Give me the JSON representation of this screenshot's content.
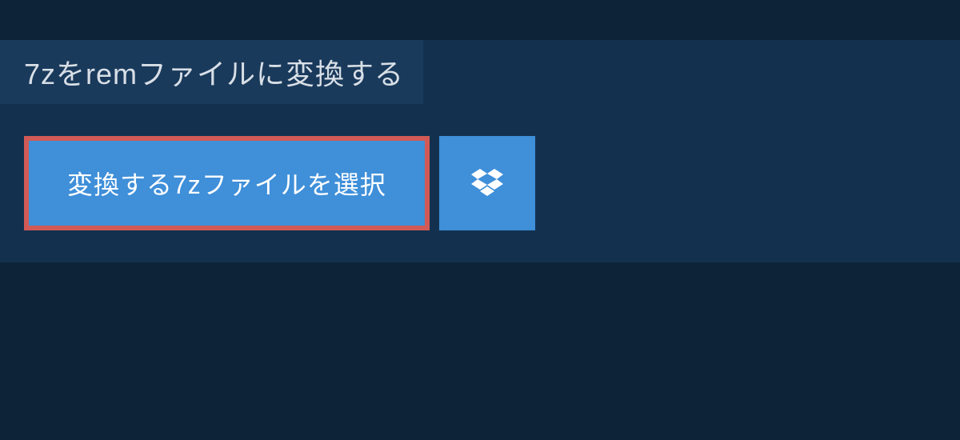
{
  "heading": "7zをremファイルに変換する",
  "select_button_label": "変換する7zファイルを選択",
  "colors": {
    "page_bg": "#0d2438",
    "panel_bg": "#13314f",
    "heading_bg": "#1a3a5c",
    "button_bg": "#3f8fd9",
    "button_border": "#d15a56",
    "text_light": "#d8dfe6",
    "text_white": "#ffffff"
  }
}
